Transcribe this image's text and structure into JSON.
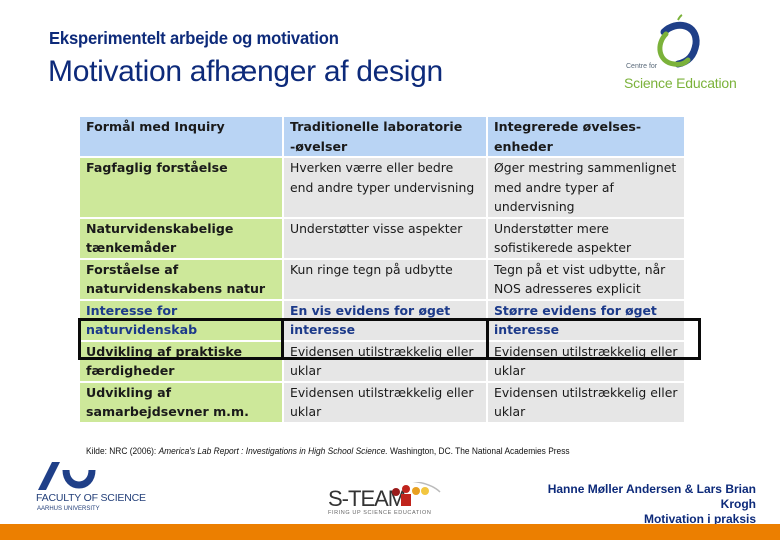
{
  "header": {
    "subtitle": "Eksperimentelt arbejde og motivation",
    "title": "Motivation afhænger af design"
  },
  "logos": {
    "cse": {
      "small": "Centre for",
      "big": "Science Education",
      "icon": "apple-logo-icon"
    },
    "au": {
      "faculty": "FACULTY OF SCIENCE",
      "university": "AARHUS UNIVERSITY",
      "icon": "au-logo-icon"
    },
    "steam": {
      "name": "S-TEAM",
      "tagline": "FIRING UP SCIENCE EDUCATION",
      "icon": "people-dots-icon"
    }
  },
  "table": {
    "headers": [
      "Formål med Inquiry",
      "Traditionelle laboratorie -øvelser",
      "Integrerede øvelses-enheder"
    ],
    "rows": [
      {
        "label": "Fagfaglig forståelse",
        "traditional": "Hverken værre eller bedre end andre typer undervisning",
        "integrated": "Øger mestring sammenlignet med andre typer af undervisning",
        "highlighted": false
      },
      {
        "label": "Naturvidenskabelige tænkemåder",
        "traditional": "Understøtter visse aspekter",
        "integrated": "Understøtter mere sofistikerede aspekter",
        "highlighted": false
      },
      {
        "label": "Forståelse af naturvidenskabens natur",
        "traditional": "Kun ringe tegn på udbytte",
        "integrated": "Tegn på et vist udbytte, når NOS adresseres explicit",
        "highlighted": false
      },
      {
        "label": "Interesse for naturvidenskab",
        "traditional": "En vis evidens for øget interesse",
        "integrated": "Større evidens for øget interesse",
        "highlighted": true
      },
      {
        "label": "Udvikling af praktiske færdigheder",
        "traditional": "Evidensen utilstrækkelig eller uklar",
        "integrated": "Evidensen utilstrækkelig eller uklar",
        "highlighted": false
      },
      {
        "label": "Udvikling af samarbejdsevner m.m.",
        "traditional": "Evidensen utilstrækkelig eller uklar",
        "integrated": "Evidensen utilstrækkelig eller uklar",
        "highlighted": false
      }
    ]
  },
  "source": {
    "prefix": "Kilde: NRC (2006): ",
    "work": "America's Lab Report : Investigations in High School Science.",
    "suffix": " Washington, DC. The National Academies Press"
  },
  "footer": {
    "authors_line1": "Hanne Møller Andersen & Lars Brian",
    "authors_line2": "Krogh",
    "presentation": "Motivation i praksis"
  },
  "colors": {
    "title": "#0d2a7a",
    "header_cell": "#b9d4f4",
    "label_cell": "#cde89a",
    "body_cell": "#e6e6e6",
    "accent_bar": "#ec7f00"
  }
}
